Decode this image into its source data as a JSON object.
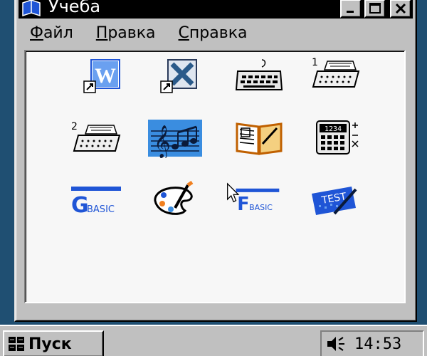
{
  "window": {
    "title": "Учеба",
    "controls": {
      "minimize": "minimize",
      "maximize": "maximize",
      "close": "close"
    }
  },
  "menu": [
    {
      "label": "Файл",
      "access_key": "Ф"
    },
    {
      "label": "Правка",
      "access_key": "П"
    },
    {
      "label": "Справка",
      "access_key": "С"
    }
  ],
  "icons": [
    {
      "name": "word-shortcut-icon",
      "kind": "word"
    },
    {
      "name": "excel-shortcut-icon",
      "kind": "excel"
    },
    {
      "name": "keyboard-trainer-icon",
      "kind": "keyboard"
    },
    {
      "name": "typewriter-1-icon",
      "kind": "typewriter",
      "number": "1"
    },
    {
      "name": "typewriter-2-icon",
      "kind": "typewriter",
      "number": "2"
    },
    {
      "name": "music-notes-icon",
      "kind": "music",
      "selected": true
    },
    {
      "name": "open-book-icon",
      "kind": "book"
    },
    {
      "name": "calculator-icon",
      "kind": "calculator",
      "label": "1234"
    },
    {
      "name": "gbasic-icon",
      "kind": "basic",
      "letter": "G",
      "label": "BASIC"
    },
    {
      "name": "paint-palette-icon",
      "kind": "palette"
    },
    {
      "name": "fbasic-icon",
      "kind": "basic",
      "letter": "F",
      "label": "BASIC"
    },
    {
      "name": "test-icon",
      "kind": "test",
      "label": "TEST"
    }
  ],
  "taskbar": {
    "start_label": "Пуск",
    "clock": "14:53"
  },
  "colors": {
    "desktop": "#1f4f72",
    "selection": "#3a8de0",
    "icon_blue": "#1f55d6"
  }
}
